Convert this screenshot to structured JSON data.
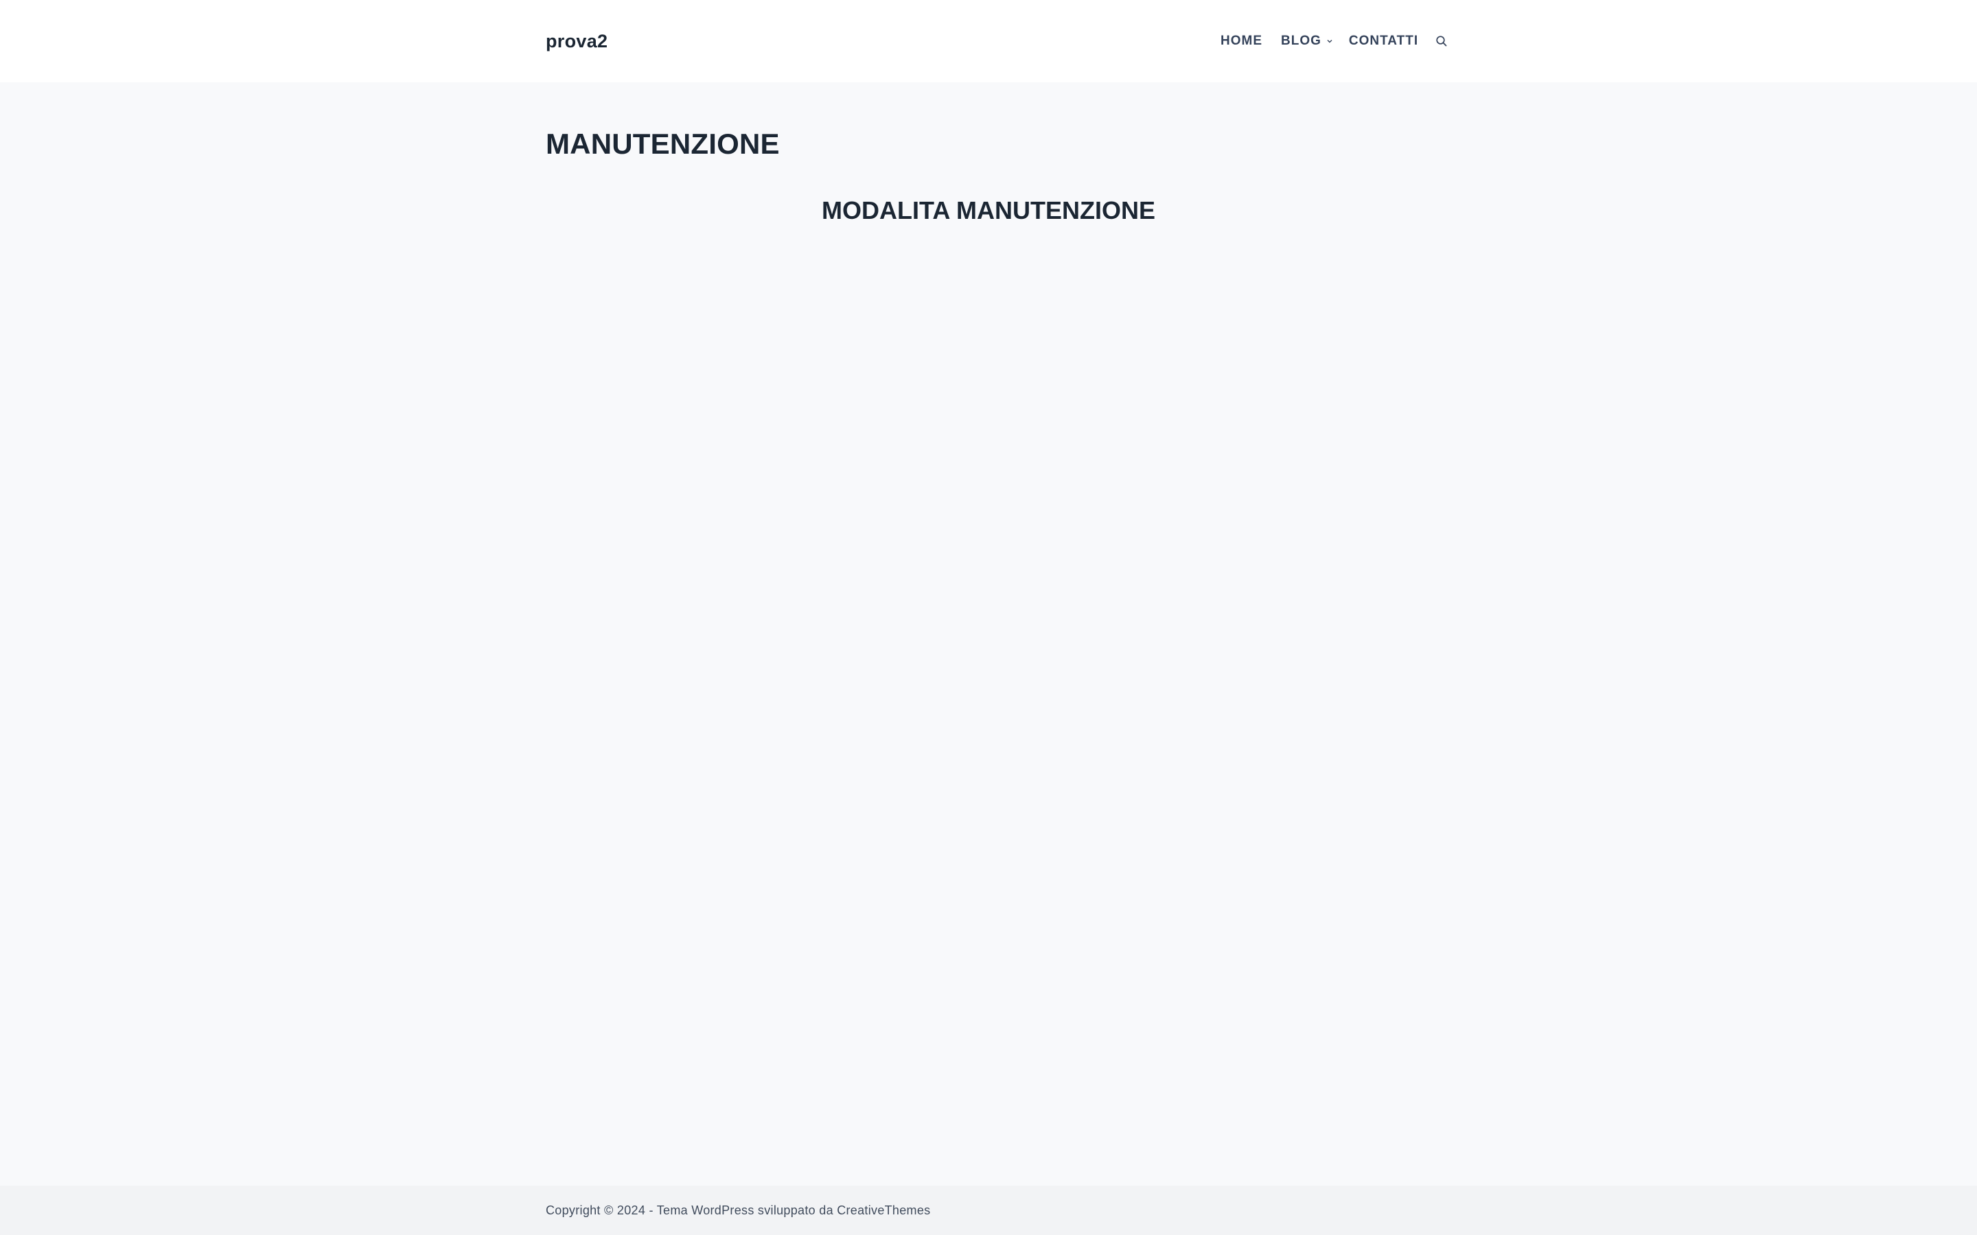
{
  "header": {
    "site_title": "prova2",
    "nav": {
      "home": "HOME",
      "blog": "BLOG",
      "contatti": "CONTATTI"
    },
    "search_icon": "search-icon"
  },
  "main": {
    "page_title": "MANUTENZIONE",
    "heading": "MODALITA MANUTENZIONE"
  },
  "footer": {
    "copyright_prefix": "Copyright © 2024 - Tema WordPress sviluppato da ",
    "author_link": "CreativeThemes"
  },
  "colors": {
    "background": "#f8f9fb",
    "header_background": "#ffffff",
    "footer_background": "#f2f3f5",
    "heading_text": "#1b2633",
    "nav_text": "#34425a"
  }
}
